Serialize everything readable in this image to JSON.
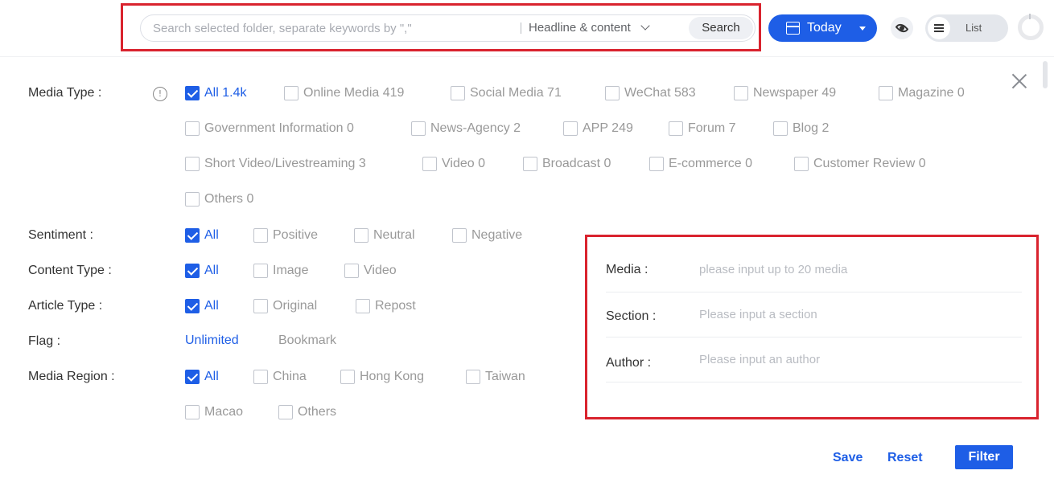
{
  "search": {
    "placeholder": "Search selected folder, separate keywords by \",\"",
    "scope": "Headline & content",
    "button": "Search"
  },
  "date_filter": {
    "label": "Today"
  },
  "view_toggle": {
    "label": "List"
  },
  "colors": {
    "accent": "#1e5ee6",
    "highlight_frame": "#d9232e"
  },
  "filters": {
    "media_type": {
      "label": "Media Type :",
      "options": [
        {
          "label": "All 1.4k",
          "checked": true
        },
        {
          "label": "Online Media 419",
          "checked": false
        },
        {
          "label": "Social Media 71",
          "checked": false
        },
        {
          "label": "WeChat 583",
          "checked": false
        },
        {
          "label": "Newspaper 49",
          "checked": false
        },
        {
          "label": "Magazine 0",
          "checked": false
        },
        {
          "label": "Government Information 0",
          "checked": false
        },
        {
          "label": "News-Agency 2",
          "checked": false
        },
        {
          "label": "APP 249",
          "checked": false
        },
        {
          "label": "Forum 7",
          "checked": false
        },
        {
          "label": "Blog 2",
          "checked": false
        },
        {
          "label": "Short Video/Livestreaming 3",
          "checked": false
        },
        {
          "label": "Video 0",
          "checked": false
        },
        {
          "label": "Broadcast 0",
          "checked": false
        },
        {
          "label": "E-commerce 0",
          "checked": false
        },
        {
          "label": "Customer Review 0",
          "checked": false
        },
        {
          "label": "Others 0",
          "checked": false
        }
      ]
    },
    "sentiment": {
      "label": "Sentiment :",
      "options": [
        {
          "label": "All",
          "checked": true
        },
        {
          "label": "Positive",
          "checked": false
        },
        {
          "label": "Neutral",
          "checked": false
        },
        {
          "label": "Negative",
          "checked": false
        }
      ]
    },
    "content_type": {
      "label": "Content Type :",
      "options": [
        {
          "label": "All",
          "checked": true
        },
        {
          "label": "Image",
          "checked": false
        },
        {
          "label": "Video",
          "checked": false
        }
      ]
    },
    "article_type": {
      "label": "Article Type :",
      "options": [
        {
          "label": "All",
          "checked": true
        },
        {
          "label": "Original",
          "checked": false
        },
        {
          "label": "Repost",
          "checked": false
        }
      ]
    },
    "flag": {
      "label": "Flag :",
      "options": [
        {
          "label": "Unlimited",
          "active": true
        },
        {
          "label": "Bookmark",
          "active": false
        }
      ]
    },
    "media_region": {
      "label": "Media Region :",
      "options": [
        {
          "label": "All",
          "checked": true
        },
        {
          "label": "China",
          "checked": false
        },
        {
          "label": "Hong Kong",
          "checked": false
        },
        {
          "label": "Taiwan",
          "checked": false
        },
        {
          "label": "Macao",
          "checked": false
        },
        {
          "label": "Others",
          "checked": false
        }
      ]
    }
  },
  "fields": {
    "media": {
      "label": "Media :",
      "placeholder": "please input up to 20 media"
    },
    "section": {
      "label": "Section :",
      "placeholder": "Please input a section"
    },
    "author": {
      "label": "Author :",
      "placeholder": "Please input an author"
    }
  },
  "actions": {
    "save": "Save",
    "reset": "Reset",
    "filter": "Filter"
  }
}
